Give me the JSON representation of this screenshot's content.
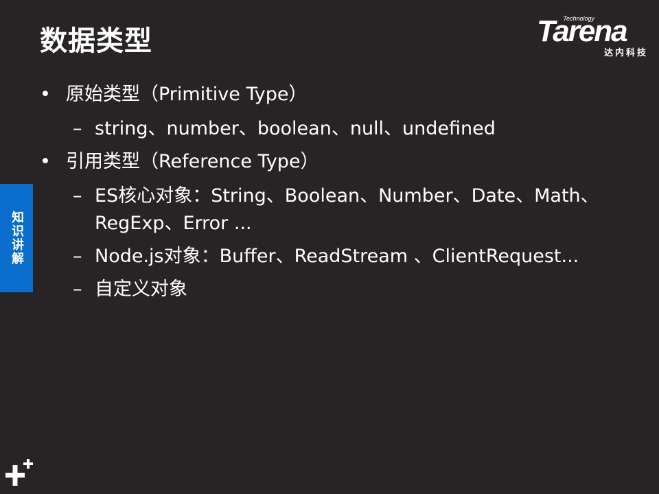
{
  "slide": {
    "title": "数据类型",
    "side_tab": "知识讲解",
    "logo": {
      "word": "Tarena",
      "tech": "Technology",
      "subtitle": "达内科技"
    },
    "bullets": [
      {
        "level": 1,
        "marker": "•",
        "text": "原始类型（Primitive Type）"
      },
      {
        "level": 2,
        "marker": "–",
        "text": "string、number、boolean、null、undefined"
      },
      {
        "level": 1,
        "marker": "•",
        "text": "引用类型（Reference Type）"
      },
      {
        "level": 2,
        "marker": "–",
        "text": "ES核心对象：String、Boolean、Number、Date、Math、RegExp、Error ..."
      },
      {
        "level": 2,
        "marker": "–",
        "text": "Node.js对象：Buffer、ReadStream 、ClientRequest..."
      },
      {
        "level": 2,
        "marker": "–",
        "text": "自定义对象"
      }
    ],
    "colors": {
      "background": "#282425",
      "accent": "#0a6ccb",
      "text": "#ffffff"
    },
    "icons": [
      "plus-icon"
    ]
  }
}
